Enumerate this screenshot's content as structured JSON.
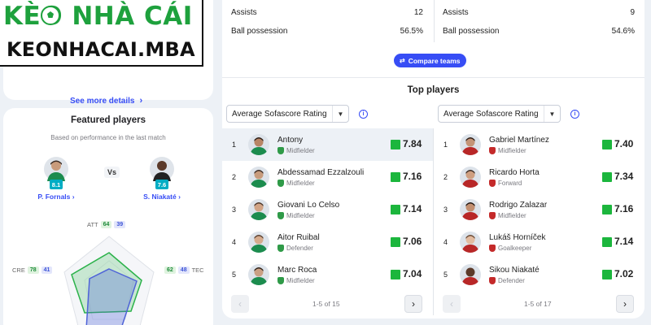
{
  "logo": {
    "line1": "KÈO NHÀ CÁI",
    "line2": "KEONHACAI.MBA"
  },
  "left": {
    "see_more": "See more details",
    "featured": {
      "title": "Featured players",
      "subtitle": "Based on performance in the last match",
      "vs": "Vs",
      "player_a": {
        "name": "P. Fornals",
        "rating": "8.1"
      },
      "player_b": {
        "name": "S. Niakaté",
        "rating": "7.6"
      }
    },
    "radar": {
      "att": {
        "label": "ATT",
        "a": "64",
        "b": "39"
      },
      "tec": {
        "label": "TEC",
        "a": "62",
        "b": "48"
      },
      "cre": {
        "label": "CRE",
        "a": "78",
        "b": "41"
      }
    }
  },
  "stats": {
    "left": [
      {
        "label": "Assists",
        "value": "12"
      },
      {
        "label": "Ball possession",
        "value": "56.5%"
      }
    ],
    "right": [
      {
        "label": "Assists",
        "value": "9"
      },
      {
        "label": "Ball possession",
        "value": "54.6%"
      }
    ],
    "compare_button": "Compare teams"
  },
  "top_players": {
    "title": "Top players",
    "home": {
      "dropdown": "Average Sofascore Rating",
      "pager": "1-5 of 15",
      "players": [
        {
          "rank": "1",
          "name": "Antony",
          "position": "Midfielder",
          "rating": "7.84"
        },
        {
          "rank": "2",
          "name": "Abdessamad Ezzalzouli",
          "position": "Midfielder",
          "rating": "7.16"
        },
        {
          "rank": "3",
          "name": "Giovani Lo Celso",
          "position": "Midfielder",
          "rating": "7.14"
        },
        {
          "rank": "4",
          "name": "Aitor Ruibal",
          "position": "Defender",
          "rating": "7.06"
        },
        {
          "rank": "5",
          "name": "Marc Roca",
          "position": "Midfielder",
          "rating": "7.04"
        }
      ]
    },
    "away": {
      "dropdown": "Average Sofascore Rating",
      "pager": "1-5 of 17",
      "players": [
        {
          "rank": "1",
          "name": "Gabriel Martínez",
          "position": "Midfielder",
          "rating": "7.40"
        },
        {
          "rank": "2",
          "name": "Ricardo Horta",
          "position": "Forward",
          "rating": "7.34"
        },
        {
          "rank": "3",
          "name": "Rodrigo Zalazar",
          "position": "Midfielder",
          "rating": "7.16"
        },
        {
          "rank": "4",
          "name": "Lukáš Horníček",
          "position": "Goalkeeper",
          "rating": "7.14"
        },
        {
          "rank": "5",
          "name": "Sikou Niakaté",
          "position": "Defender",
          "rating": "7.02"
        }
      ]
    }
  },
  "colors": {
    "accent": "#374df5",
    "rating_green": "#1cb63d",
    "home_radar": "#2bb24a",
    "away_radar": "#4f63d8",
    "betis_green": "#2f9a48",
    "braga_red": "#c42a2a"
  }
}
